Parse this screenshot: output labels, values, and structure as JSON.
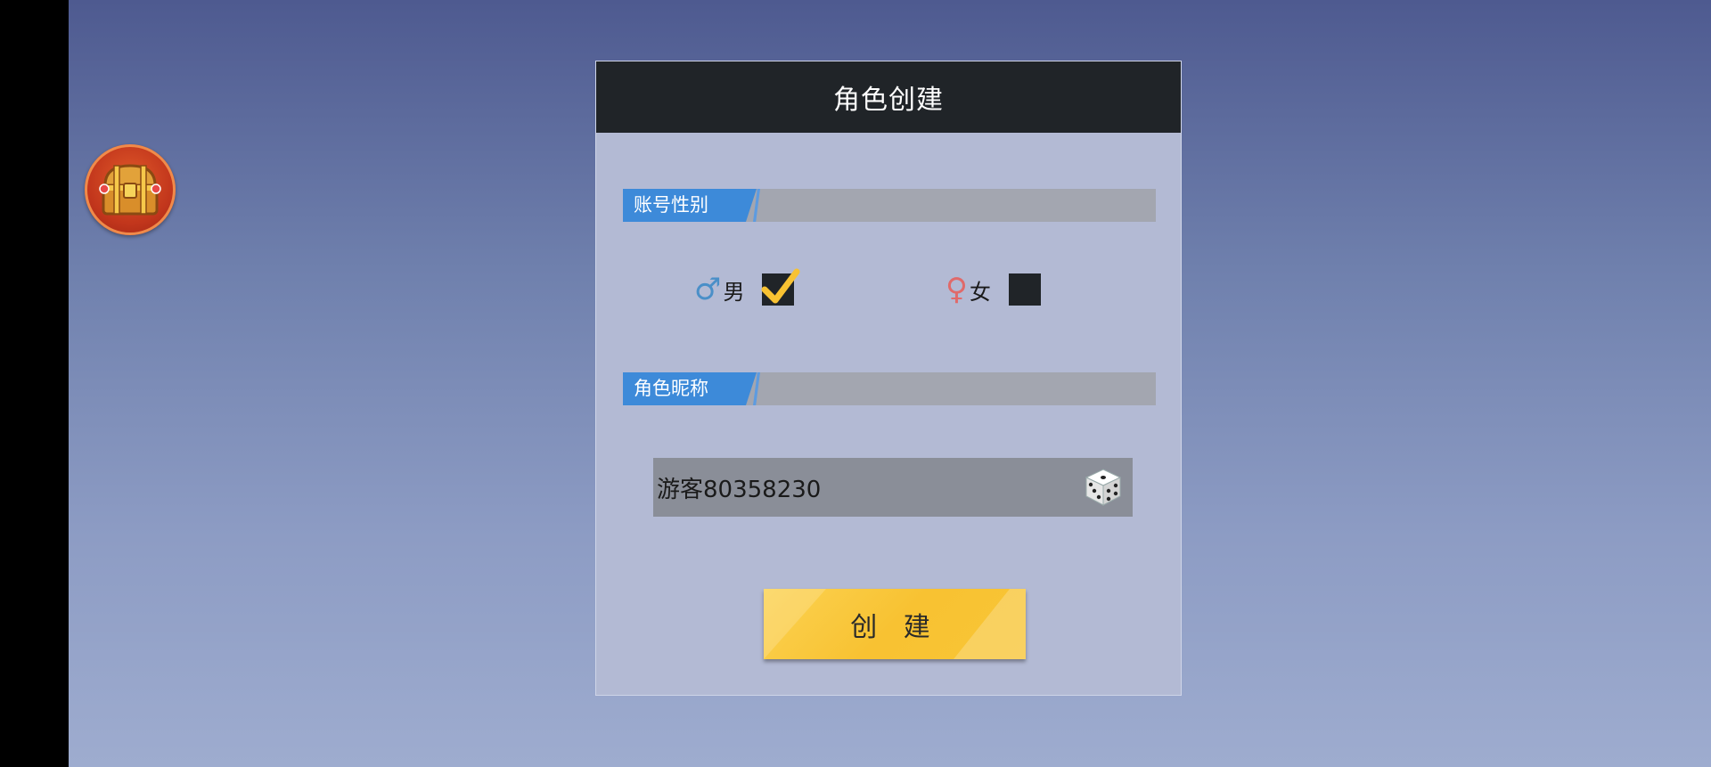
{
  "dialog": {
    "title": "角色创建",
    "gender_section_label": "账号性别",
    "name_section_label": "角色昵称",
    "create_button_label": "创 建"
  },
  "gender": {
    "male_symbol": "♂",
    "male_label": "男",
    "male_checked": true,
    "female_symbol": "♀",
    "female_label": "女",
    "female_checked": false,
    "male_color": "#4a8fc8",
    "female_color": "#e06a6a"
  },
  "nickname": {
    "value": "游客80358230"
  },
  "icons": {
    "chest": "treasure-chest-icon",
    "dice": "dice-icon",
    "check": "checkmark-icon"
  },
  "colors": {
    "header_bg": "#202428",
    "section_accent": "#3d8ad9",
    "button_yellow": "#f8c232"
  }
}
